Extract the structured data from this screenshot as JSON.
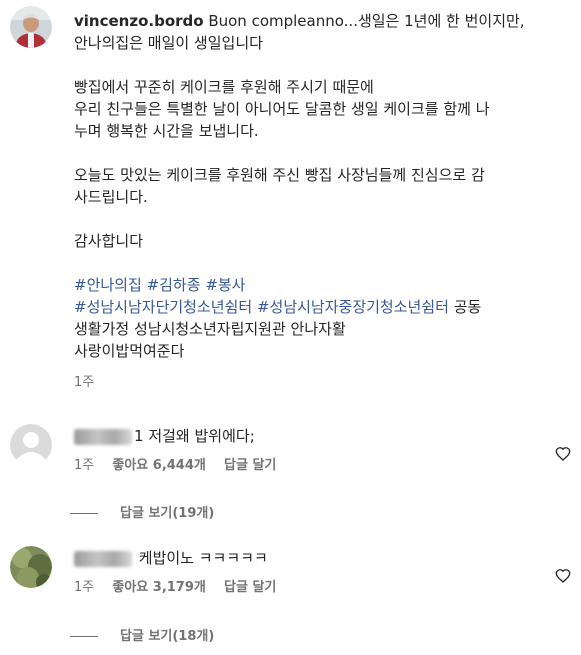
{
  "post": {
    "username": "vincenzo.bordo",
    "caption_line1_rest": " Buon compleanno...생일은 1년에 한 번이지만,",
    "caption_line2": "안나의집은 매일이 생일입니다",
    "para2_line1": "빵집에서 꾸준히 케이크를 후원해 주시기 때문에",
    "para2_line2": "우리 친구들은 특별한 날이 아니어도 달콤한 생일 케이크를 함께 나",
    "para2_line3": "누며 행복한 시간을 보냅니다.",
    "para3_line1": "오늘도 맛있는 케이크를 후원해 주신 빵집 사장님들께 진심으로 감",
    "para3_line2": "사드립니다.",
    "thanks": "감사합니다",
    "hashtags_line1": [
      "#안나의집",
      "#김하종",
      "#봉사"
    ],
    "hashtags_line2": [
      "#성남시남자단기청소년쉼터",
      "#성남시남자중장기청소년쉼터"
    ],
    "tail_line2": " 공동",
    "tail_line3": "생활가정 성남시청소년자립지원관 안나자활",
    "tail_line4": "사랑이밥먹여준다",
    "time": "1주"
  },
  "comments": [
    {
      "username_suffix": "1",
      "text": "저걸왜 밥위에다;",
      "time": "1주",
      "likes": "좋아요 6,444개",
      "reply": "답글 달기",
      "view_replies": "답글 보기(19개)"
    },
    {
      "username_suffix": "",
      "text": "케밥이노 ㅋㅋㅋㅋㅋ",
      "time": "1주",
      "likes": "좋아요 3,179개",
      "reply": "답글 달기",
      "view_replies": "답글 보기(18개)"
    }
  ],
  "colors": {
    "text": "#262626",
    "secondary": "#737373",
    "hashtag": "#385898",
    "background": "#ffffff"
  },
  "icons": {
    "like": "heart-outline-icon",
    "default_avatar": "person-placeholder-icon"
  }
}
